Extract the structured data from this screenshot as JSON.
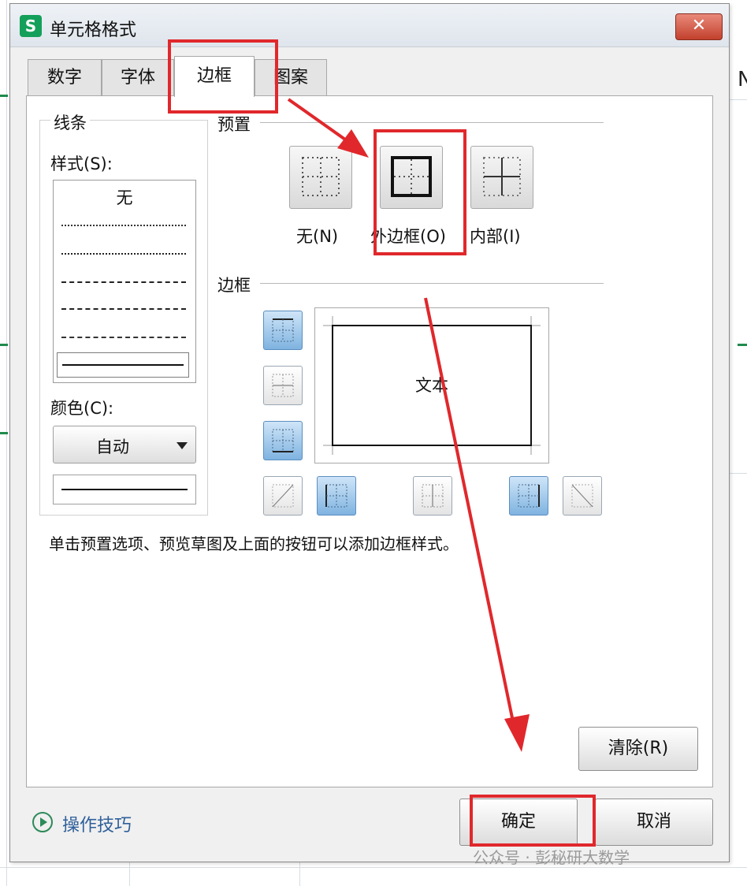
{
  "dialog": {
    "app_icon": "S",
    "title": "单元格格式",
    "close_icon": "✕"
  },
  "tabs": [
    {
      "label": "数字"
    },
    {
      "label": "字体"
    },
    {
      "label": "边框",
      "active": true
    },
    {
      "label": "图案"
    }
  ],
  "line_group": {
    "title": "线条",
    "style_label": "样式(S):",
    "style_none": "无",
    "color_label": "颜色(C):",
    "color_value": "自动"
  },
  "preset": {
    "title": "预置",
    "buttons": [
      {
        "label": "无(N)",
        "icon": "no-border-icon"
      },
      {
        "label": "外边框(O)",
        "icon": "outline-border-icon"
      },
      {
        "label": "内部(I)",
        "icon": "inside-border-icon"
      }
    ]
  },
  "border": {
    "title": "边框",
    "preview_text": "文本"
  },
  "hint": "单击预置选项、预览草图及上面的按钮可以添加边框样式。",
  "buttons": {
    "clear": "清除(R)",
    "ok": "确定",
    "cancel": "取消"
  },
  "tips": "操作技巧",
  "watermark": "公众号 · 彭秘研大数学",
  "side_glyph": "N",
  "colors": {
    "highlight": "#e0282c",
    "accent_blue": "#7fb3e0",
    "app_green": "#14a05a"
  }
}
